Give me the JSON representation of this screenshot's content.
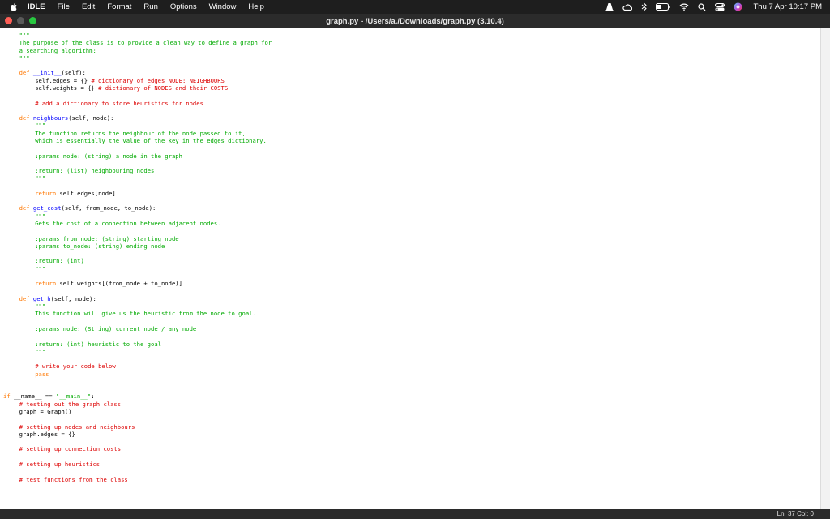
{
  "menubar": {
    "app_name": "IDLE",
    "items": [
      "File",
      "Edit",
      "Format",
      "Run",
      "Options",
      "Window",
      "Help"
    ],
    "clock": "Thu 7 Apr  10:17 PM",
    "status_icons": [
      "vlc-icon",
      "creative-cloud-icon",
      "bluetooth-icon",
      "battery-icon",
      "wifi-icon",
      "search-icon",
      "control-center-icon",
      "siri-icon"
    ]
  },
  "window": {
    "title": "graph.py - /Users/a./Downloads/graph.py (3.10.4)",
    "traffic_colors": [
      "#ff5f57",
      "#5a5a5a",
      "#28c840"
    ]
  },
  "colors": {
    "string": "#00aa00",
    "comment": "#dd0000",
    "keyword": "#ff7700",
    "definition": "#0000ff"
  },
  "code_lines": [
    {
      "indent": 4,
      "segments": [
        {
          "t": "\"\"\"",
          "c": "string"
        }
      ]
    },
    {
      "indent": 4,
      "segments": [
        {
          "t": "The purpose of the class is to provide a clean way to define a graph for",
          "c": "string"
        }
      ]
    },
    {
      "indent": 4,
      "segments": [
        {
          "t": "a searching algorithm:",
          "c": "string"
        }
      ]
    },
    {
      "indent": 4,
      "segments": [
        {
          "t": "\"\"\"",
          "c": "string"
        }
      ]
    },
    null,
    {
      "indent": 4,
      "segments": [
        {
          "t": "def ",
          "c": "keyword"
        },
        {
          "t": "__init__",
          "c": "def"
        },
        {
          "t": "(self):",
          "c": "plain"
        }
      ]
    },
    {
      "indent": 8,
      "segments": [
        {
          "t": "self.edges = {} ",
          "c": "plain"
        },
        {
          "t": "# dictionary of edges NODE: NEIGHBOURS",
          "c": "comment"
        }
      ]
    },
    {
      "indent": 8,
      "segments": [
        {
          "t": "self.weights = {} ",
          "c": "plain"
        },
        {
          "t": "# dictionary of NODES and their COSTS",
          "c": "comment"
        }
      ]
    },
    null,
    {
      "indent": 8,
      "segments": [
        {
          "t": "# add a dictionary to store heuristics for nodes",
          "c": "comment"
        }
      ]
    },
    null,
    {
      "indent": 4,
      "segments": [
        {
          "t": "def ",
          "c": "keyword"
        },
        {
          "t": "neighbours",
          "c": "def"
        },
        {
          "t": "(self, node):",
          "c": "plain"
        }
      ]
    },
    {
      "indent": 8,
      "segments": [
        {
          "t": "\"\"\"",
          "c": "string"
        }
      ]
    },
    {
      "indent": 8,
      "segments": [
        {
          "t": "The function returns the neighbour of the node passed to it,",
          "c": "string"
        }
      ]
    },
    {
      "indent": 8,
      "segments": [
        {
          "t": "which is essentially the value of the key in the edges dictionary.",
          "c": "string"
        }
      ]
    },
    null,
    {
      "indent": 8,
      "segments": [
        {
          "t": ":params node: (string) a node in the graph",
          "c": "string"
        }
      ]
    },
    null,
    {
      "indent": 8,
      "segments": [
        {
          "t": ":return: (list) neighbouring nodes",
          "c": "string"
        }
      ]
    },
    {
      "indent": 8,
      "segments": [
        {
          "t": "\"\"\"",
          "c": "string"
        }
      ]
    },
    null,
    {
      "indent": 8,
      "segments": [
        {
          "t": "return ",
          "c": "keyword"
        },
        {
          "t": "self.edges[node]",
          "c": "plain"
        }
      ]
    },
    null,
    {
      "indent": 4,
      "segments": [
        {
          "t": "def ",
          "c": "keyword"
        },
        {
          "t": "get_cost",
          "c": "def"
        },
        {
          "t": "(self, from_node, to_node):",
          "c": "plain"
        }
      ]
    },
    {
      "indent": 8,
      "segments": [
        {
          "t": "\"\"\"",
          "c": "string"
        }
      ]
    },
    {
      "indent": 8,
      "segments": [
        {
          "t": "Gets the cost of a connection between adjacent nodes.",
          "c": "string"
        }
      ]
    },
    null,
    {
      "indent": 8,
      "segments": [
        {
          "t": ":params from_node: (string) starting node",
          "c": "string"
        }
      ]
    },
    {
      "indent": 8,
      "segments": [
        {
          "t": ":params to_node: (string) ending node",
          "c": "string"
        }
      ]
    },
    null,
    {
      "indent": 8,
      "segments": [
        {
          "t": ":return: (int)",
          "c": "string"
        }
      ]
    },
    {
      "indent": 8,
      "segments": [
        {
          "t": "\"\"\"",
          "c": "string"
        }
      ]
    },
    null,
    {
      "indent": 8,
      "segments": [
        {
          "t": "return ",
          "c": "keyword"
        },
        {
          "t": "self.weights[(from_node + to_node)]",
          "c": "plain"
        }
      ]
    },
    null,
    {
      "indent": 4,
      "segments": [
        {
          "t": "def ",
          "c": "keyword"
        },
        {
          "t": "get_h",
          "c": "def"
        },
        {
          "t": "(self, node):",
          "c": "plain"
        }
      ]
    },
    {
      "indent": 8,
      "segments": [
        {
          "t": "\"\"\"",
          "c": "string"
        }
      ]
    },
    {
      "indent": 8,
      "segments": [
        {
          "t": "This function will give us the heuristic from the node to goal.",
          "c": "string"
        }
      ]
    },
    null,
    {
      "indent": 8,
      "segments": [
        {
          "t": ":params node: (String) current node / any node",
          "c": "string"
        }
      ]
    },
    null,
    {
      "indent": 8,
      "segments": [
        {
          "t": ":return: (int) heuristic to the goal",
          "c": "string"
        }
      ]
    },
    {
      "indent": 8,
      "segments": [
        {
          "t": "\"\"\"",
          "c": "string"
        }
      ]
    },
    null,
    {
      "indent": 8,
      "segments": [
        {
          "t": "# write your code below",
          "c": "comment"
        }
      ]
    },
    {
      "indent": 8,
      "segments": [
        {
          "t": "pass",
          "c": "keyword"
        }
      ]
    },
    null,
    null,
    {
      "indent": 0,
      "segments": [
        {
          "t": "if ",
          "c": "keyword"
        },
        {
          "t": "__name__ == ",
          "c": "plain"
        },
        {
          "t": "\"__main__\"",
          "c": "string"
        },
        {
          "t": ":",
          "c": "plain"
        }
      ]
    },
    {
      "indent": 4,
      "segments": [
        {
          "t": "# testing out the graph class",
          "c": "comment"
        }
      ]
    },
    {
      "indent": 4,
      "segments": [
        {
          "t": "graph = Graph()",
          "c": "plain"
        }
      ]
    },
    null,
    {
      "indent": 4,
      "segments": [
        {
          "t": "# setting up nodes and neighbours",
          "c": "comment"
        }
      ]
    },
    {
      "indent": 4,
      "segments": [
        {
          "t": "graph.edges = {}",
          "c": "plain"
        }
      ]
    },
    null,
    {
      "indent": 4,
      "segments": [
        {
          "t": "# setting up connection costs",
          "c": "comment"
        }
      ]
    },
    null,
    {
      "indent": 4,
      "segments": [
        {
          "t": "# setting up heuristics",
          "c": "comment"
        }
      ]
    },
    null,
    {
      "indent": 4,
      "segments": [
        {
          "t": "# test functions from the class",
          "c": "comment"
        }
      ]
    }
  ],
  "status": {
    "position": "Ln: 37  Col: 0"
  }
}
